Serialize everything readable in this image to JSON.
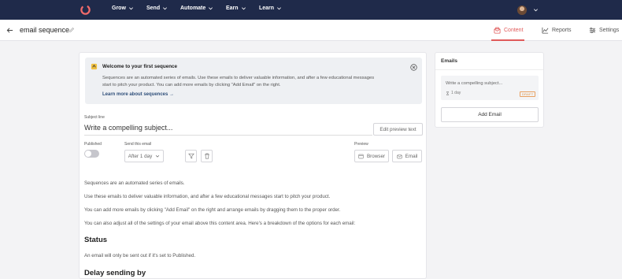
{
  "nav": {
    "items": [
      {
        "label": "Grow"
      },
      {
        "label": "Send"
      },
      {
        "label": "Automate"
      },
      {
        "label": "Earn"
      },
      {
        "label": "Learn"
      }
    ]
  },
  "header": {
    "title": "email sequence",
    "tabs": [
      {
        "label": "Content",
        "active": true
      },
      {
        "label": "Reports",
        "active": false
      },
      {
        "label": "Settings",
        "active": false
      }
    ]
  },
  "welcome": {
    "title": "Welcome to your first sequence",
    "line1": "Sequences are an automated series of emails. Use these emails to deliver valuable information, and after a few educational messages",
    "line2": "start to pitch your product. You can add more emails by clicking \"Add Email\" on the right.",
    "link": "Learn more about sequences →"
  },
  "editor": {
    "subject_label": "Subject line",
    "subject_placeholder": "Write a compelling subject...",
    "preview_text_button": "Edit preview text",
    "published_label": "Published",
    "send_label": "Send this email",
    "delay_value": "After 1 day",
    "preview_label": "Preview",
    "browser_button": "Browser",
    "email_button": "Email"
  },
  "content": {
    "p1": "Sequences are an automated series of emails.",
    "p2": "Use these emails to deliver valuable information, and after a few educational messages start to pitch your product.",
    "p3": "You can add more emails by clicking \"Add Email\" on the right and arrange emails by dragging them to the proper order.",
    "p4": "You can also adjust all of the settings of your email above this content area. Here's a breakdown of the options for each email:",
    "h_status": "Status",
    "p5": "An email will only be sent out if it's set to Published.",
    "h_delay": "Delay sending by"
  },
  "side": {
    "title": "Emails",
    "card_title": "Write a compelling subject...",
    "card_delay": "1 day",
    "card_badge": "DRAFT",
    "add_button": "Add Email"
  },
  "colors": {
    "nav_bg": "#1f2a4a",
    "accent": "#e05a5a",
    "draft": "#e09040"
  }
}
